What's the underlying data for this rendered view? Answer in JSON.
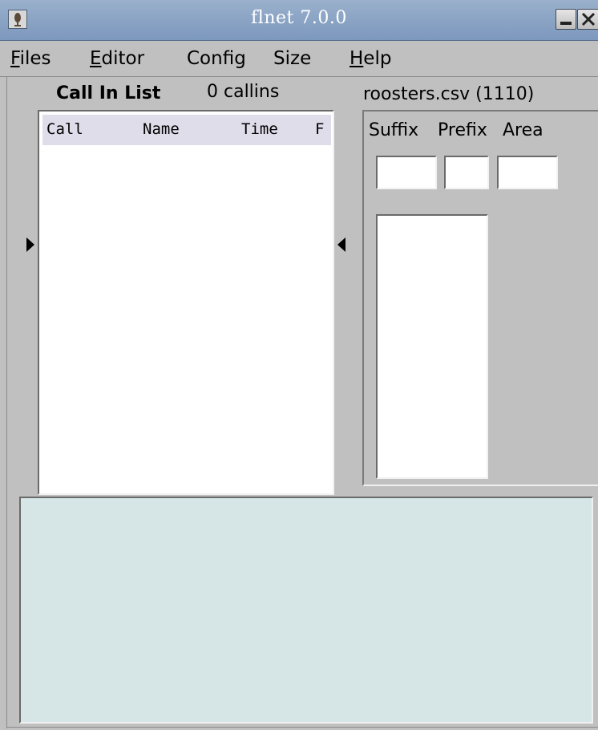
{
  "window": {
    "title": "flnet 7.0.0"
  },
  "menu": {
    "files": {
      "underline": "F",
      "rest": "iles"
    },
    "editor": {
      "underline": "E",
      "rest": "ditor"
    },
    "config": {
      "label": "Config"
    },
    "size": {
      "label": "Size"
    },
    "help": {
      "underline": "H",
      "rest": "elp"
    }
  },
  "calllist": {
    "title": "Call In List",
    "count": "0 callins",
    "columns": [
      "Call",
      "Name",
      "Time",
      "F"
    ],
    "rows": []
  },
  "roster": {
    "file_label": "roosters.csv (1110)",
    "suffix_label": "Suffix",
    "prefix_label": "Prefix",
    "area_label": "Area",
    "suffix_value": "",
    "prefix_value": "",
    "area_value": "",
    "matches": []
  },
  "info": {
    "text": ""
  },
  "icons": {
    "app": "mic-icon",
    "minimize": "minimize-icon",
    "close": "close-icon",
    "expand_left": "arrow-right-icon",
    "collapse_right": "arrow-left-icon"
  },
  "colors": {
    "titlebar": "#7c98bd",
    "window_bg": "#c0c0c0",
    "info_bg": "#d6e6e6",
    "column_header_bg": "#e0ddeb"
  }
}
